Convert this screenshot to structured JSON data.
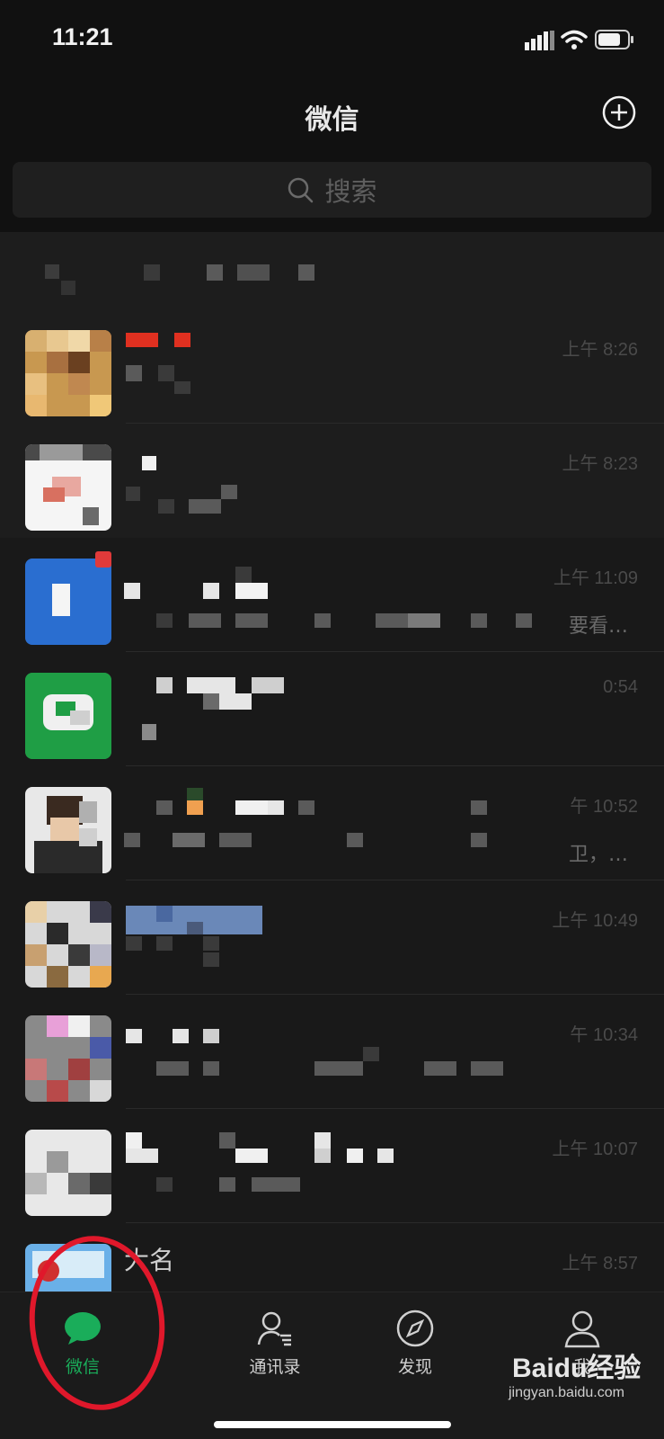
{
  "status_bar": {
    "time": "11:21"
  },
  "header": {
    "title": "微信"
  },
  "search": {
    "placeholder": "搜索"
  },
  "chats": [
    {
      "time": "上午 8:26",
      "preview": ""
    },
    {
      "time": "上午 8:23",
      "preview": ""
    },
    {
      "time": "上午 11:09",
      "preview": "要看…"
    },
    {
      "time": "0:54",
      "preview": ""
    },
    {
      "time": "午 10:52",
      "preview": "卫，…"
    },
    {
      "time": "上午 10:49",
      "preview": ""
    },
    {
      "time": "午 10:34",
      "preview": ""
    },
    {
      "time": "上午 10:07",
      "preview": ""
    },
    {
      "time": "上午 8:57",
      "name": "大名",
      "preview": ""
    }
  ],
  "tabs": [
    {
      "label": "微信",
      "icon": "chat-bubble-icon",
      "active": true
    },
    {
      "label": "通讯录",
      "icon": "contacts-icon",
      "active": false
    },
    {
      "label": "发现",
      "icon": "compass-icon",
      "active": false
    },
    {
      "label": "我",
      "icon": "person-icon",
      "active": false
    }
  ],
  "watermark": {
    "brand": "Baidu经验",
    "url": "jingyan.baidu.com"
  },
  "colors": {
    "accent": "#1aad5a",
    "background": "#111111",
    "annotation": "#e0182b"
  }
}
